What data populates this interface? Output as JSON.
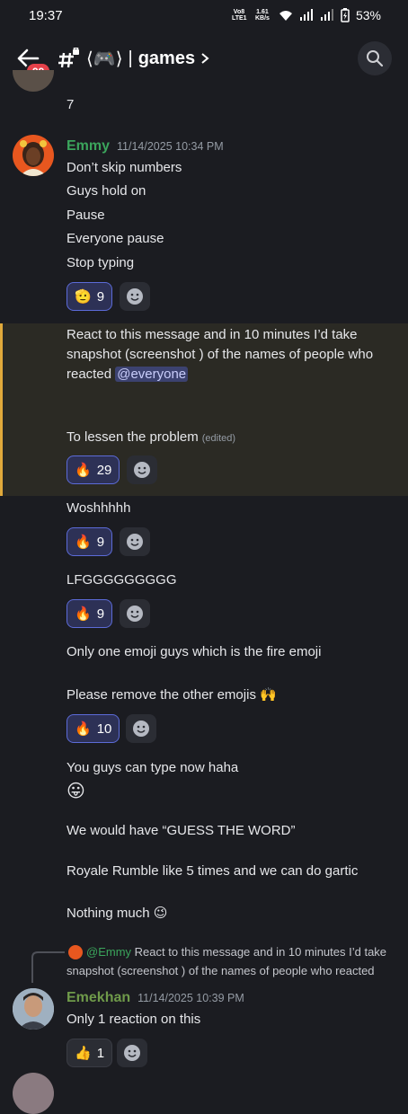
{
  "status": {
    "time": "19:37",
    "net_label": "Vo8 LTE1",
    "speed": "1.61 KB/s",
    "battery": "53%"
  },
  "header": {
    "unread_badge": "99",
    "channel_emoji": "⟨🎮⟩",
    "channel_name": "games"
  },
  "messages": {
    "prev_text": "7",
    "emmy": {
      "username": "Emmy",
      "timestamp": "11/14/2025 10:34 PM",
      "lines": [
        "Don’t skip numbers",
        "Guys hold on",
        "Pause",
        "Everyone pause",
        "Stop typing"
      ],
      "reaction_count": "9"
    },
    "highlight": {
      "text": "React to this message and in 10 minutes I’d take snapshot (screenshot ) of the names  of  people who reacted",
      "mention": "@everyone",
      "lessen": "To lessen the problem",
      "edited": "(edited)",
      "reaction_count": "29"
    },
    "woshh": {
      "text": "Woshhhhh",
      "reaction_count": "9"
    },
    "lfg": {
      "text": "LFGGGGGGGGG",
      "reaction_count": "9"
    },
    "one_emoji": {
      "line1": "Only one emoji guys which is the fire emoji",
      "line2": "Please remove the other emojis 🙌",
      "reaction_count": "10"
    },
    "type_now": {
      "line1": "You guys can type now haha",
      "emoji": "😛"
    },
    "guess": "We would have “GUESS THE WORD”",
    "royale": "Royale Rumble like 5 times and we can do gartic",
    "nothing": "Nothing much 😉",
    "emekhan": {
      "reply_user": "@Emmy",
      "reply_text1": "React to this message and in 10 minutes I’d take",
      "reply_text2": "snapshot (screenshot ) of the names  of  people who reacted",
      "username": "Emekhan",
      "timestamp": "11/14/2025 10:39 PM",
      "text": "Only 1 reaction on this",
      "reaction_count": "1"
    }
  },
  "icons": {
    "fire": "🔥",
    "thumbs": "👍",
    "saluting": "🫡"
  },
  "colors": {
    "emmy_name": "#3ba55c",
    "emekhan_name": "#6f9a4a",
    "accent": "#5c6bd8",
    "highlight_bar": "#e0a93b"
  }
}
